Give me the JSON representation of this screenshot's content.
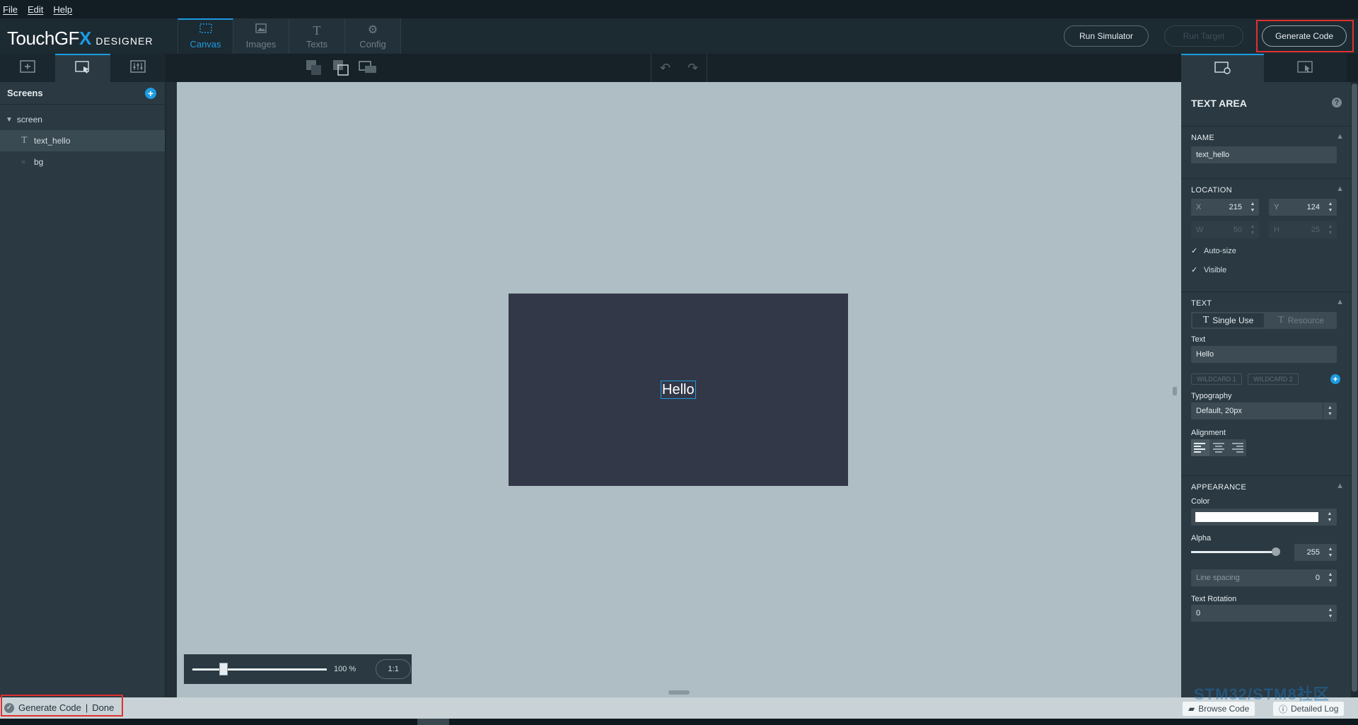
{
  "menu": {
    "file": "File",
    "edit": "Edit",
    "help": "Help"
  },
  "logo": {
    "main": "TouchGF",
    "accent": "X",
    "sub": "DESIGNER"
  },
  "main_tabs": [
    {
      "label": "Canvas",
      "icon": "canvas-icon"
    },
    {
      "label": "Images",
      "icon": "images-icon"
    },
    {
      "label": "Texts",
      "icon": "texts-icon"
    },
    {
      "label": "Config",
      "icon": "config-icon"
    }
  ],
  "toolbar": {
    "run_simulator": "Run Simulator",
    "run_target": "Run Target",
    "generate_code": "Generate Code"
  },
  "left_panel": {
    "header": "Screens",
    "tree": {
      "screen": "screen",
      "children": [
        "text_hello",
        "bg"
      ]
    }
  },
  "canvas": {
    "hello_text": "Hello",
    "zoom_label": "100 %",
    "zoom_one_to_one": "1:1",
    "zoom_level": 0.23
  },
  "properties": {
    "title": "TEXT AREA",
    "name_section": "NAME",
    "name_value": "text_hello",
    "location_section": "LOCATION",
    "x_label": "X",
    "x_value": "215",
    "y_label": "Y",
    "y_value": "124",
    "w_label": "W",
    "w_value": "50",
    "h_label": "H",
    "h_value": "25",
    "auto_size": "Auto-size",
    "visible": "Visible",
    "text_section": "TEXT",
    "single_use": "Single Use",
    "resource": "Resource",
    "text_label": "Text",
    "text_value": "Hello",
    "wildcard1": "WILDCARD 1",
    "wildcard2": "WILDCARD 2",
    "typography_label": "Typography",
    "typography_value": "Default, 20px",
    "alignment_label": "Alignment",
    "appearance_section": "APPEARANCE",
    "color_label": "Color",
    "color_value": "#FFFFFF",
    "alpha_label": "Alpha",
    "alpha_value": "255",
    "line_spacing_label": "Line spacing",
    "line_spacing_value": "0",
    "text_rotation_label": "Text Rotation",
    "text_rotation_value": "0"
  },
  "status": {
    "message": "Generate Code",
    "separator": "|",
    "state": "Done",
    "browse_code": "Browse Code",
    "detailed_log": "Detailed Log"
  },
  "watermark": "STM32/STM8社区",
  "colors": {
    "accent": "#1e9be0",
    "highlight": "#e0302f",
    "canvas_bg": "#aebec4",
    "screen_bg": "#333848"
  }
}
